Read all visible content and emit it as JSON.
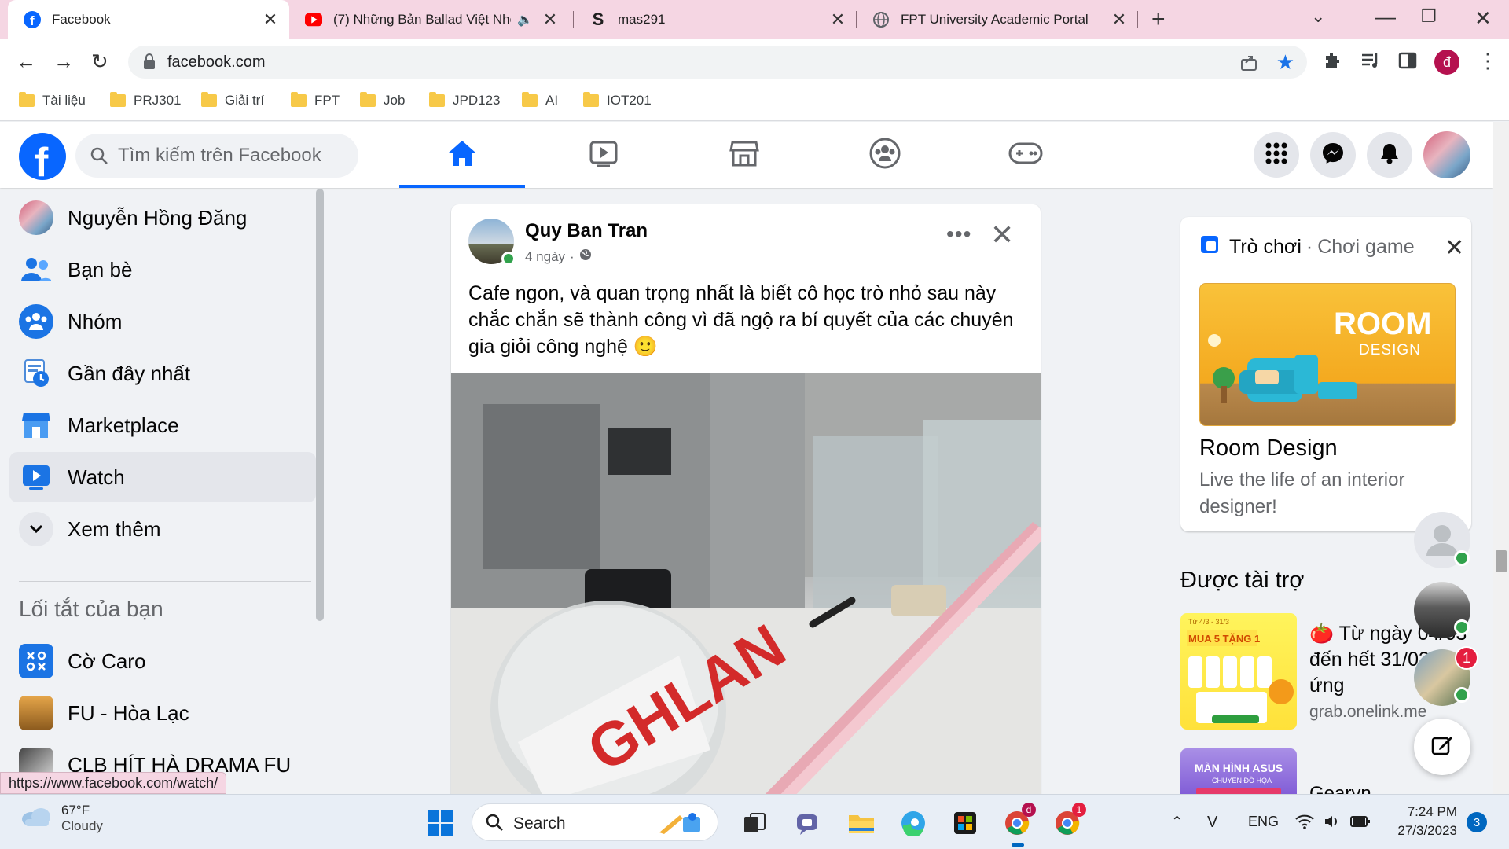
{
  "browser": {
    "tabs": [
      {
        "title": "Facebook",
        "favicon": "facebook-icon"
      },
      {
        "title": "(7) Những Bản Ballad Việt Nhẹ",
        "favicon": "youtube-icon",
        "audio": "speaker-icon"
      },
      {
        "title": "mas291",
        "favicon": "s-icon"
      },
      {
        "title": "FPT University Academic Portal",
        "favicon": "globe-icon"
      }
    ],
    "url": "facebook.com",
    "bookmarks": [
      "Tài liệu",
      "PRJ301",
      "Giải trí",
      "FPT",
      "Job",
      "JPD123",
      "AI",
      "IOT201"
    ],
    "profile_letter": "đ",
    "status_url": "https://www.facebook.com/watch/"
  },
  "facebook": {
    "search_placeholder": "Tìm kiếm trên Facebook",
    "nav_tabs": [
      "home-icon",
      "watch-icon",
      "marketplace-icon",
      "groups-icon",
      "gaming-icon"
    ],
    "sidebar": {
      "items": [
        {
          "label": "Nguyễn Hồng Đăng",
          "icon": "profile-avatar"
        },
        {
          "label": "Bạn bè",
          "icon": "friends-icon"
        },
        {
          "label": "Nhóm",
          "icon": "groups-icon"
        },
        {
          "label": "Gần đây nhất",
          "icon": "recent-icon"
        },
        {
          "label": "Marketplace",
          "icon": "marketplace-icon"
        },
        {
          "label": "Watch",
          "icon": "watch-icon"
        },
        {
          "label": "Xem thêm",
          "icon": "chevron-down-icon"
        }
      ],
      "shortcuts_heading": "Lối tắt của bạn",
      "shortcuts": [
        {
          "label": "Cờ Caro",
          "icon": "caro-icon"
        },
        {
          "label": "FU - Hòa Lạc",
          "icon": "group-thumbnail"
        },
        {
          "label": "CLB HÍT HÀ DRAMA FU",
          "icon": "group-thumbnail"
        }
      ]
    },
    "post": {
      "author": "Quy Ban Tran",
      "time": "4 ngày",
      "privacy": "globe-icon",
      "text": "Cafe ngon, và quan trọng nhất là biết cô học trò nhỏ sau này chắc chắn sẽ thành công vì đã ngộ ra bí quyết của các chuyên gia giỏi công nghệ 🙂",
      "photo_text": "GHLAN"
    },
    "game_card": {
      "title": "Trò chơi",
      "subtitle": "Chơi game",
      "image_text_1": "ROOM",
      "image_text_2": "DESIGN",
      "name": "Room Design",
      "description": "Live the life of an interior designer!"
    },
    "sponsored": {
      "heading": "Được tài trợ",
      "ad1": {
        "text": "🍅 Từ ngày 04/03 đến hết 31/03 trên ứng",
        "link": "grab.onelink.me",
        "img_line1": "Từ 4/3 - 31/3",
        "img_line2": "MUA 5 TẶNG 1"
      },
      "ad2": {
        "text": "Gearvn",
        "img_line1": "MÀN HÌNH ASUS",
        "img_line2": "CHUYÊN ĐỒ HỌA"
      }
    },
    "contacts_badge": "1"
  },
  "taskbar": {
    "temperature": "67°F",
    "condition": "Cloudy",
    "search_label": "Search",
    "language": "ENG",
    "time": "7:24 PM",
    "date": "27/3/2023",
    "notifications": "3",
    "chrome_badge_1": "đ",
    "chrome_badge_2": "1"
  }
}
